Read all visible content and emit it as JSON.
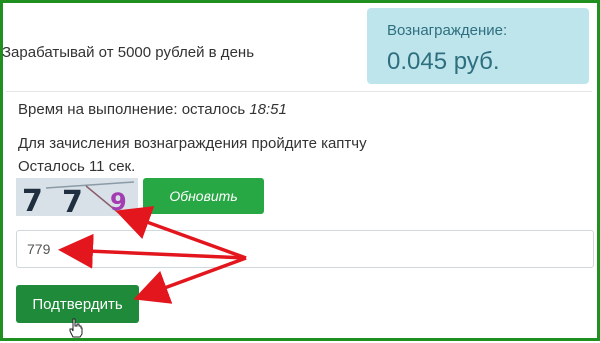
{
  "promo_text": "Зарабатывай от 5000 рублей в день",
  "reward": {
    "label": "Вознаграждение:",
    "value": "0.045 руб."
  },
  "timer": {
    "label": "Время на выполнение: осталось",
    "value": "18:51"
  },
  "captcha_note": "Для зачисления вознаграждения пройдите каптчу",
  "seconds_left": "Осталось 11 сек.",
  "captcha": {
    "digits": [
      "7",
      "7",
      "9"
    ]
  },
  "refresh_label": "Обновить",
  "answer_value": "779",
  "confirm_label": "Подтвердить",
  "colors": {
    "frame": "#1f8f1f",
    "reward_bg": "#bfe5ec",
    "button_green": "#28a745",
    "arrow_red": "#e3161d"
  }
}
